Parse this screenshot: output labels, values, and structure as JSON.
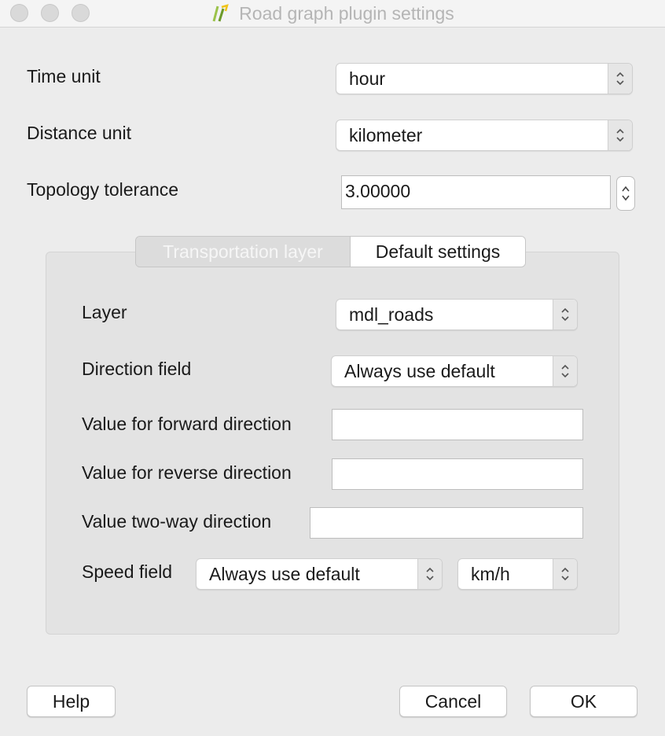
{
  "window": {
    "title": "Road graph plugin settings"
  },
  "general": {
    "time_unit_label": "Time unit",
    "time_unit_value": "hour",
    "distance_unit_label": "Distance unit",
    "distance_unit_value": "kilometer",
    "topology_tolerance_label": "Topology tolerance",
    "topology_tolerance_value": "3.00000"
  },
  "tabs": [
    {
      "label": "Transportation layer",
      "active": false
    },
    {
      "label": "Default settings",
      "active": true
    }
  ],
  "transport": {
    "layer_label": "Layer",
    "layer_value": "mdl_roads",
    "direction_field_label": "Direction field",
    "direction_field_value": "Always use default",
    "forward_label": "Value for forward direction",
    "forward_value": "",
    "reverse_label": "Value for reverse direction",
    "reverse_value": "",
    "twoway_label": "Value two-way direction",
    "twoway_value": "",
    "speed_field_label": "Speed field",
    "speed_field_value": "Always use default",
    "speed_unit_value": "km/h"
  },
  "buttons": {
    "help": "Help",
    "cancel": "Cancel",
    "ok": "OK"
  },
  "colors": {
    "window_bg": "#ececec",
    "group_bg": "#e3e3e3",
    "title_text": "#b5b5b5"
  }
}
